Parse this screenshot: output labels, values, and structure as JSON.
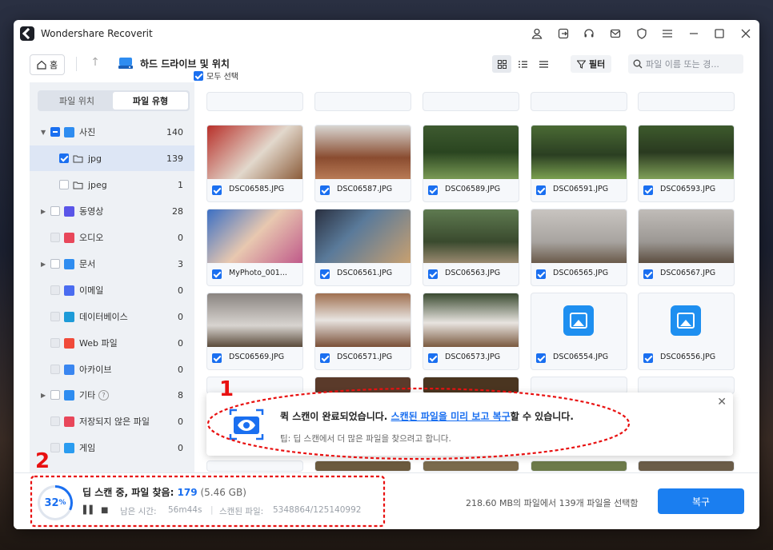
{
  "app": {
    "title": "Wondershare Recoverit"
  },
  "toolbar": {
    "home_label": "홈",
    "breadcrumb": "하드 드라이브 및 위치",
    "filter_label": "필터",
    "search_placeholder": "파일 이름 또는 경..."
  },
  "sidebar": {
    "tabs": [
      "파일 위치",
      "파일 유형"
    ],
    "categories": [
      {
        "label": "사진",
        "count": "140"
      },
      {
        "label": "jpg",
        "count": "139"
      },
      {
        "label": "jpeg",
        "count": "1"
      },
      {
        "label": "동영상",
        "count": "28"
      },
      {
        "label": "오디오",
        "count": "0"
      },
      {
        "label": "문서",
        "count": "3"
      },
      {
        "label": "이메일",
        "count": "0"
      },
      {
        "label": "데이터베이스",
        "count": "0"
      },
      {
        "label": "Web 파일",
        "count": "0"
      },
      {
        "label": "아카이브",
        "count": "0"
      },
      {
        "label": "기타",
        "count": "8"
      },
      {
        "label": "저장되지 않은 파일",
        "count": "0"
      },
      {
        "label": "게임",
        "count": "0"
      }
    ]
  },
  "main": {
    "select_all": "모두 선택",
    "files": [
      "DSC06585.JPG",
      "DSC06587.JPG",
      "DSC06589.JPG",
      "DSC06591.JPG",
      "DSC06593.JPG",
      "MyPhoto_001...",
      "DSC06561.JPG",
      "DSC06563.JPG",
      "DSC06565.JPG",
      "DSC06567.JPG",
      "DSC06569.JPG",
      "DSC06571.JPG",
      "DSC06573.JPG",
      "DSC06554.JPG",
      "DSC06556.JPG"
    ]
  },
  "notification": {
    "title_before": "퀵 스캔이 완료되었습니다. ",
    "title_link": "스캔된 파일을 미리 보고 복구",
    "title_after": "할 수 있습니다.",
    "tip": "팁: 딥 스캔에서 더 많은 파일을 찾으려고 합니다."
  },
  "status": {
    "progress_percent": "32",
    "percent_sign": "%",
    "scan_label": "딥 스캔 중, 파일 찾음: ",
    "found_count": "179",
    "found_size": " (5.46 GB)",
    "remaining_label": "남은 시간:",
    "remaining_value": "56m44s",
    "scanned_label": "스캔된 파일:",
    "scanned_value": "5348864/125140992",
    "selection_info": "218.60 MB의 파일에서 139개 파일을 선택함",
    "recover_label": "복구"
  },
  "annotations": {
    "one": "1",
    "two": "2"
  },
  "colors": {
    "accent": "#1a6ff0",
    "annotation": "#e81010"
  }
}
